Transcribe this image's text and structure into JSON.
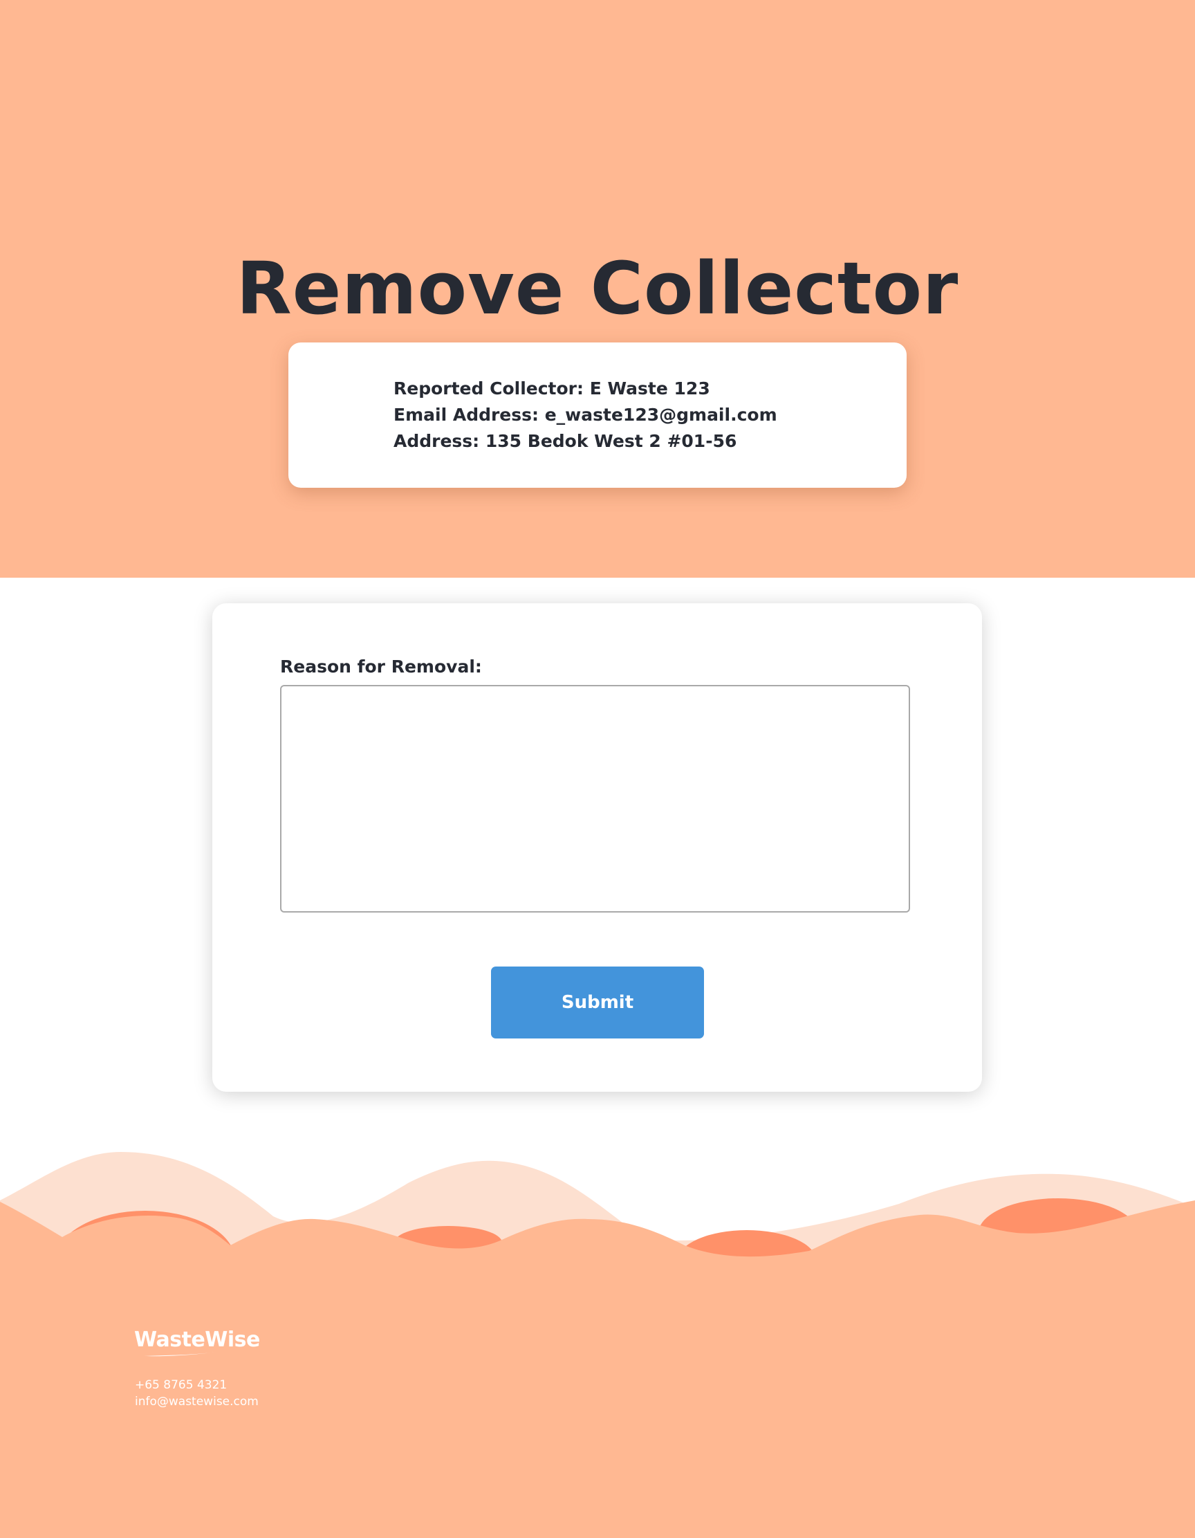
{
  "hero": {
    "title": "Remove Collector",
    "collector": {
      "name_line": "Reported Collector: E Waste 123",
      "email_line": "Email Address: e_waste123@gmail.com",
      "address_line": "Address: 135 Bedok West 2 #01-56"
    }
  },
  "form": {
    "reason_label": "Reason for Removal:",
    "reason_value": "",
    "reason_placeholder": "",
    "submit_label": "Submit"
  },
  "footer": {
    "logo_text": "WasteWise",
    "phone": "+65 8765 4321",
    "email": "info@wastewise.com"
  },
  "colors": {
    "hero_background": "#ffb892",
    "wave_light": "#fde0d0",
    "wave_accent": "#ff9169",
    "footer_background": "#ffb892",
    "text_dark": "#262a33",
    "submit_button": "#4394db"
  }
}
